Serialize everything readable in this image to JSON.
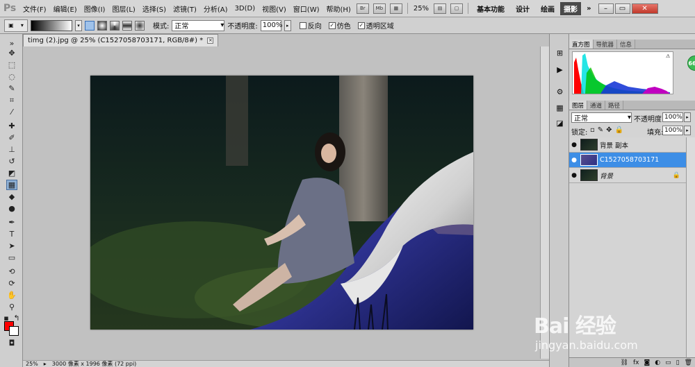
{
  "menubar": {
    "logo": "Ps",
    "items": [
      "文件(F)",
      "编辑(E)",
      "图像(I)",
      "图层(L)",
      "选择(S)",
      "滤镜(T)",
      "分析(A)",
      "3D(D)",
      "视图(V)",
      "窗口(W)",
      "帮助(H)"
    ],
    "bridge_label": "Br",
    "minibridge_label": "Mb",
    "zoom": "25%",
    "workspaces": [
      "基本功能",
      "设计",
      "绘画",
      "摄影"
    ],
    "more": "»",
    "window_buttons": [
      "–",
      "▭",
      "✕"
    ]
  },
  "options": {
    "mode_label": "模式:",
    "mode_value": "正常",
    "opacity_label": "不透明度:",
    "opacity_value": "100%",
    "reverse_label": "反向",
    "dither_label": "仿色",
    "transparency_label": "透明区域",
    "reverse_checked": false,
    "dither_checked": true,
    "transparency_checked": true
  },
  "document": {
    "tab_title": "timg (2).jpg @ 25% (C1527058703171, RGB/8#) *",
    "tab_close": "×"
  },
  "status": {
    "zoom": "25%",
    "doc_info": "3000 像素 x 1996 像素 (72 ppi)"
  },
  "panels": {
    "top_tabs": [
      "直方图",
      "导航器",
      "信息"
    ],
    "layer_tabs": [
      "图层",
      "通道",
      "路径"
    ],
    "blend_mode": "正常",
    "opacity_label": "不透明度:",
    "opacity_value": "100%",
    "lock_label": "锁定:",
    "fill_label": "填充:",
    "fill_value": "100%",
    "layers": [
      {
        "name": "背景 副本",
        "selected": false,
        "italic": false,
        "locked": false
      },
      {
        "name": "C1527058703171",
        "selected": true,
        "italic": false,
        "locked": false
      },
      {
        "name": "背景",
        "selected": false,
        "italic": true,
        "locked": true
      }
    ],
    "footer_icons": [
      "link-icon",
      "fx-icon",
      "mask-icon",
      "adjustment-icon",
      "group-icon",
      "new-layer-icon",
      "trash-icon"
    ]
  },
  "badge": "66%",
  "watermark": {
    "logo": "Bai 经验",
    "url": "jingyan.baidu.com"
  },
  "colors": {
    "foreground": "#ff0000",
    "background": "#ffffff",
    "selection": "#3d8ee6"
  }
}
